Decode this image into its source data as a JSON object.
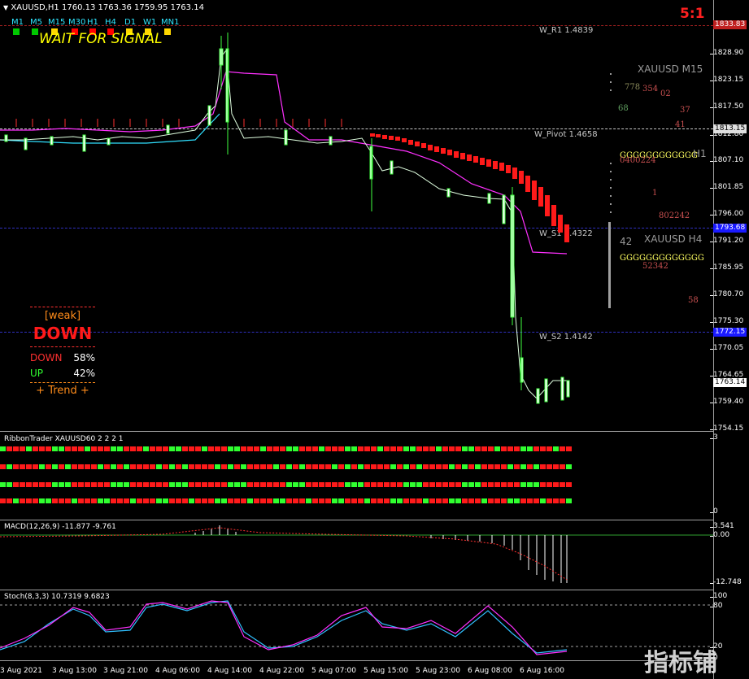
{
  "main": {
    "title": "XAUUSD,H1",
    "ohlc": "1760.13 1763.36 1759.95 1763.14",
    "ratio": "5:1",
    "signal": "WAIT FOR SIGNAL",
    "timeframes": [
      {
        "label": "M1",
        "color": "#00c800"
      },
      {
        "label": "M5",
        "color": "#00c800"
      },
      {
        "label": "M15",
        "color": "#ffd700"
      },
      {
        "label": "M30",
        "color": "#ff0000"
      },
      {
        "label": "H1",
        "color": "#ff0000"
      },
      {
        "label": "H4",
        "color": "#ff0000"
      },
      {
        "label": "D1",
        "color": "#ffd700"
      },
      {
        "label": "W1",
        "color": "#ffd700"
      },
      {
        "label": "MN1",
        "color": "#ffd700"
      }
    ],
    "levels": {
      "r1": "W_R1 1.4839",
      "pivot": "W_Pivot 1.4658",
      "s1": "W_S1 1.4322",
      "s2": "W_S2 1.4142"
    },
    "price_axis": [
      "1828.90",
      "1823.15",
      "1817.50",
      "1812.80",
      "1807.10",
      "1801.85",
      "1796.00",
      "1791.20",
      "1785.95",
      "1780.70",
      "1775.30",
      "1770.05",
      "1764.65",
      "1759.40",
      "1754.15"
    ],
    "tags": {
      "top": "1833.83",
      "pivot": "1813.15",
      "blue1": "1793.68",
      "blue2": "1772.15",
      "current": "1763.14"
    },
    "mtf_labels": {
      "m15": "XAUUSD M15",
      "h1": "H1",
      "h4": "XAUUSD H4",
      "h4_num": "42"
    },
    "trend_panel": {
      "strength": "[weak]",
      "direction": "DOWN",
      "down_label": "DOWN",
      "down_pct": "58%",
      "up_label": "UP",
      "up_pct": "42%",
      "trend": "+ Trend +"
    }
  },
  "ribbon": {
    "title": "RibbonTrader XAUUSD60 2 2 2 1",
    "axis_top": "3",
    "axis_bottom": "0"
  },
  "macd": {
    "title": "MACD(12,26,9) -11.877 -9.761",
    "axis": [
      "3.541",
      "0.00",
      "-12.748"
    ]
  },
  "stoch": {
    "title": "Stoch(8,3,3) 10.7319 9.6823",
    "axis": [
      "100",
      "80",
      "20",
      "0"
    ]
  },
  "time_axis": [
    "3 Aug 2021",
    "3 Aug 13:00",
    "3 Aug 21:00",
    "4 Aug 06:00",
    "4 Aug 14:00",
    "4 Aug 22:00",
    "5 Aug 07:00",
    "5 Aug 15:00",
    "5 Aug 23:00",
    "6 Aug 08:00",
    "6 Aug 16:00"
  ],
  "watermark": "指标铺"
}
